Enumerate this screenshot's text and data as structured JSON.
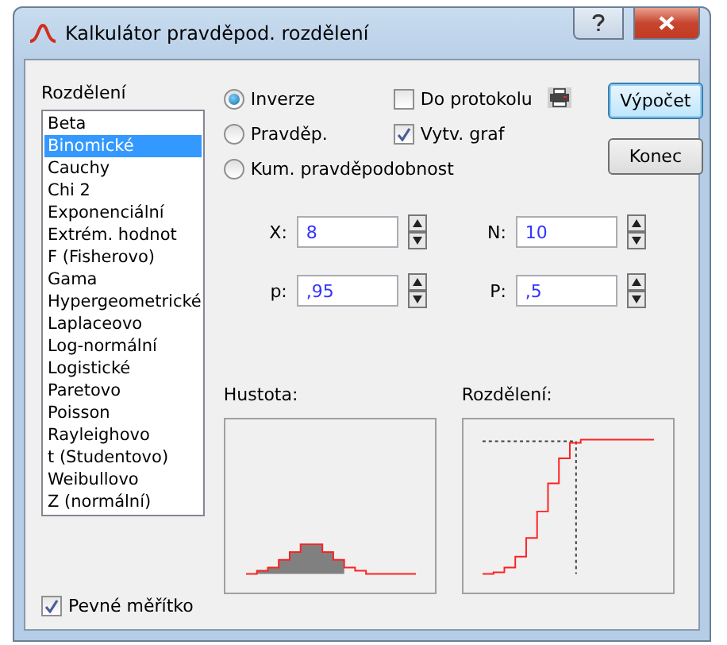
{
  "window": {
    "title": "Kalkulátor pravděpod. rozdělení"
  },
  "distribution_label": "Rozdělení",
  "distributions": [
    {
      "label": "Beta",
      "selected": false
    },
    {
      "label": "Binomické",
      "selected": true
    },
    {
      "label": "Cauchy",
      "selected": false
    },
    {
      "label": "Chi 2",
      "selected": false
    },
    {
      "label": "Exponenciální",
      "selected": false
    },
    {
      "label": "Extrém. hodnot",
      "selected": false
    },
    {
      "label": "F (Fisherovo)",
      "selected": false
    },
    {
      "label": "Gama",
      "selected": false
    },
    {
      "label": "Hypergeometrické",
      "selected": false
    },
    {
      "label": "Laplaceovo",
      "selected": false
    },
    {
      "label": "Log-normální",
      "selected": false
    },
    {
      "label": "Logistické",
      "selected": false
    },
    {
      "label": "Paretovo",
      "selected": false
    },
    {
      "label": "Poisson",
      "selected": false
    },
    {
      "label": "Rayleighovo",
      "selected": false
    },
    {
      "label": "t (Studentovo)",
      "selected": false
    },
    {
      "label": "Weibullovo",
      "selected": false
    },
    {
      "label": "Z (normální)",
      "selected": false
    }
  ],
  "fixed_scale": {
    "label": "Pevné měřítko",
    "checked": true
  },
  "modes": [
    {
      "label": "Inverze",
      "selected": true
    },
    {
      "label": "Pravděp.",
      "selected": false
    },
    {
      "label": "Kum. pravděpodobnost",
      "selected": false
    }
  ],
  "options": [
    {
      "label": "Do protokolu",
      "checked": false
    },
    {
      "label": "Vytv. graf",
      "checked": true
    }
  ],
  "buttons": [
    {
      "label": "Výpočet",
      "focused": true
    },
    {
      "label": "Konec",
      "focused": false
    }
  ],
  "fields": [
    {
      "label": "X:",
      "value": "8"
    },
    {
      "label": "N:",
      "value": "10"
    },
    {
      "label": "p:",
      "value": ",95"
    },
    {
      "label": "P:",
      "value": ",5"
    }
  ],
  "charts": [
    {
      "title": "Hustota:",
      "kind": "density"
    },
    {
      "title": "Rozdělení:",
      "kind": "cumulative"
    }
  ]
}
